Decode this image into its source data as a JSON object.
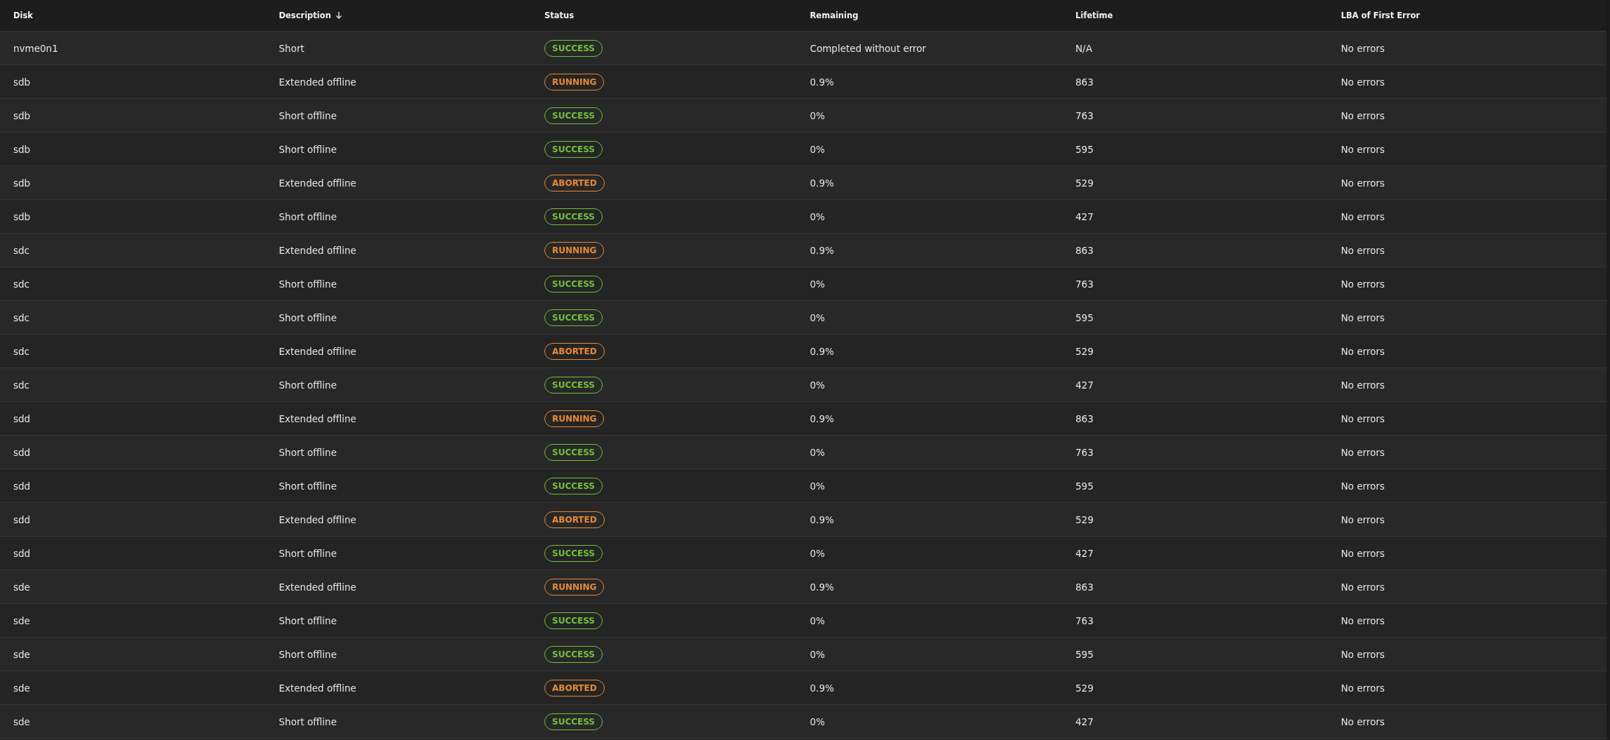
{
  "table": {
    "columns": [
      {
        "label": "Disk",
        "sorted": false
      },
      {
        "label": "Description",
        "sorted": true
      },
      {
        "label": "Status",
        "sorted": false
      },
      {
        "label": "Remaining",
        "sorted": false
      },
      {
        "label": "Lifetime",
        "sorted": false
      },
      {
        "label": "LBA of First Error",
        "sorted": false
      }
    ],
    "rows": [
      {
        "disk": "nvme0n1",
        "description": "Short",
        "status": {
          "label": "SUCCESS",
          "kind": "success"
        },
        "remaining": "Completed without error",
        "lifetime": "N/A",
        "lba": "No errors"
      },
      {
        "disk": "sdb",
        "description": "Extended offline",
        "status": {
          "label": "RUNNING",
          "kind": "warning"
        },
        "remaining": "0.9%",
        "lifetime": "863",
        "lba": "No errors"
      },
      {
        "disk": "sdb",
        "description": "Short offline",
        "status": {
          "label": "SUCCESS",
          "kind": "success"
        },
        "remaining": "0%",
        "lifetime": "763",
        "lba": "No errors"
      },
      {
        "disk": "sdb",
        "description": "Short offline",
        "status": {
          "label": "SUCCESS",
          "kind": "success"
        },
        "remaining": "0%",
        "lifetime": "595",
        "lba": "No errors"
      },
      {
        "disk": "sdb",
        "description": "Extended offline",
        "status": {
          "label": "ABORTED",
          "kind": "warning"
        },
        "remaining": "0.9%",
        "lifetime": "529",
        "lba": "No errors"
      },
      {
        "disk": "sdb",
        "description": "Short offline",
        "status": {
          "label": "SUCCESS",
          "kind": "success"
        },
        "remaining": "0%",
        "lifetime": "427",
        "lba": "No errors"
      },
      {
        "disk": "sdc",
        "description": "Extended offline",
        "status": {
          "label": "RUNNING",
          "kind": "warning"
        },
        "remaining": "0.9%",
        "lifetime": "863",
        "lba": "No errors"
      },
      {
        "disk": "sdc",
        "description": "Short offline",
        "status": {
          "label": "SUCCESS",
          "kind": "success"
        },
        "remaining": "0%",
        "lifetime": "763",
        "lba": "No errors"
      },
      {
        "disk": "sdc",
        "description": "Short offline",
        "status": {
          "label": "SUCCESS",
          "kind": "success"
        },
        "remaining": "0%",
        "lifetime": "595",
        "lba": "No errors"
      },
      {
        "disk": "sdc",
        "description": "Extended offline",
        "status": {
          "label": "ABORTED",
          "kind": "warning"
        },
        "remaining": "0.9%",
        "lifetime": "529",
        "lba": "No errors"
      },
      {
        "disk": "sdc",
        "description": "Short offline",
        "status": {
          "label": "SUCCESS",
          "kind": "success"
        },
        "remaining": "0%",
        "lifetime": "427",
        "lba": "No errors"
      },
      {
        "disk": "sdd",
        "description": "Extended offline",
        "status": {
          "label": "RUNNING",
          "kind": "warning"
        },
        "remaining": "0.9%",
        "lifetime": "863",
        "lba": "No errors"
      },
      {
        "disk": "sdd",
        "description": "Short offline",
        "status": {
          "label": "SUCCESS",
          "kind": "success"
        },
        "remaining": "0%",
        "lifetime": "763",
        "lba": "No errors"
      },
      {
        "disk": "sdd",
        "description": "Short offline",
        "status": {
          "label": "SUCCESS",
          "kind": "success"
        },
        "remaining": "0%",
        "lifetime": "595",
        "lba": "No errors"
      },
      {
        "disk": "sdd",
        "description": "Extended offline",
        "status": {
          "label": "ABORTED",
          "kind": "warning"
        },
        "remaining": "0.9%",
        "lifetime": "529",
        "lba": "No errors"
      },
      {
        "disk": "sdd",
        "description": "Short offline",
        "status": {
          "label": "SUCCESS",
          "kind": "success"
        },
        "remaining": "0%",
        "lifetime": "427",
        "lba": "No errors"
      },
      {
        "disk": "sde",
        "description": "Extended offline",
        "status": {
          "label": "RUNNING",
          "kind": "warning"
        },
        "remaining": "0.9%",
        "lifetime": "863",
        "lba": "No errors"
      },
      {
        "disk": "sde",
        "description": "Short offline",
        "status": {
          "label": "SUCCESS",
          "kind": "success"
        },
        "remaining": "0%",
        "lifetime": "763",
        "lba": "No errors"
      },
      {
        "disk": "sde",
        "description": "Short offline",
        "status": {
          "label": "SUCCESS",
          "kind": "success"
        },
        "remaining": "0%",
        "lifetime": "595",
        "lba": "No errors"
      },
      {
        "disk": "sde",
        "description": "Extended offline",
        "status": {
          "label": "ABORTED",
          "kind": "warning"
        },
        "remaining": "0.9%",
        "lifetime": "529",
        "lba": "No errors"
      },
      {
        "disk": "sde",
        "description": "Short offline",
        "status": {
          "label": "SUCCESS",
          "kind": "success"
        },
        "remaining": "0%",
        "lifetime": "427",
        "lba": "No errors"
      }
    ]
  }
}
